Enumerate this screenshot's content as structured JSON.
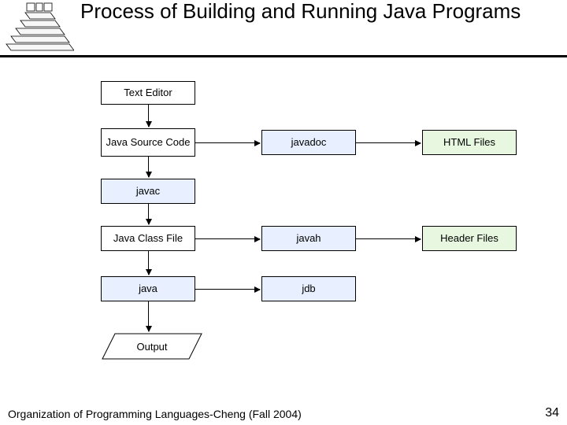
{
  "title": "Process of Building and Running Java Programs",
  "boxes": {
    "text_editor": "Text Editor",
    "java_source": "Java Source Code",
    "javadoc": "javadoc",
    "html_files": "HTML Files",
    "javac": "javac",
    "class_file": "Java Class File",
    "javah": "javah",
    "header_files": "Header Files",
    "java": "java",
    "jdb": "jdb",
    "output": "Output"
  },
  "footer": "Organization of Programming Languages-Cheng (Fall 2004)",
  "page_number": "34"
}
